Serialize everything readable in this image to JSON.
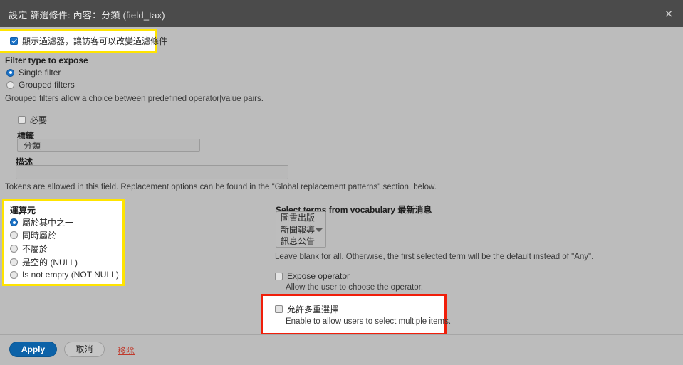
{
  "titlebar": {
    "title": "設定 篩選條件: 內容：分類 (field_tax)",
    "close_icon": "×"
  },
  "expose": {
    "checkbox_label": "顯示過濾器，讓訪客可以改變過濾條件",
    "checked": true
  },
  "filter_type": {
    "title": "Filter type to expose",
    "options": [
      {
        "label": "Single filter",
        "selected": true
      },
      {
        "label": "Grouped filters",
        "selected": false
      }
    ],
    "hint": "Grouped filters allow a choice between predefined operator|value pairs."
  },
  "settings": {
    "required_label": "必要",
    "label_caption": "標籤",
    "label_value": "分類",
    "description_caption": "描述",
    "description_value": "",
    "tokens_hint": "Tokens are allowed in this field. Replacement options can be found in the \"Global replacement patterns\" section, below."
  },
  "operator": {
    "title": "運算元",
    "options": [
      {
        "label": "屬於其中之一",
        "selected": true
      },
      {
        "label": "同時屬於",
        "selected": false
      },
      {
        "label": "不屬於",
        "selected": false
      },
      {
        "label": "是空的 (NULL)",
        "selected": false
      },
      {
        "label": "Is not empty (NOT NULL)",
        "selected": false
      }
    ]
  },
  "vocabulary": {
    "title": "Select terms from vocabulary 最新消息",
    "options": [
      "圖書出版",
      "新聞報導",
      "訊息公告"
    ],
    "hint": "Leave blank for all. Otherwise, the first selected term will be the default instead of \"Any\"."
  },
  "expose_operator": {
    "label": "Expose operator",
    "hint": "Allow the user to choose the operator.",
    "checked": false
  },
  "multiple_select": {
    "label": "允許多重選擇",
    "hint": "Enable to allow users to select multiple items.",
    "checked": false
  },
  "footer": {
    "apply_label": "Apply",
    "cancel_label": "取消",
    "remove_label": "移除"
  },
  "colors": {
    "titlebar_bg": "#4b4b4b",
    "body_bg": "#bcbcbc",
    "highlight_yellow": "#ffe400",
    "highlight_red": "#f01e0a",
    "accent_blue": "#0c62a8",
    "link_red": "#c0392b"
  }
}
